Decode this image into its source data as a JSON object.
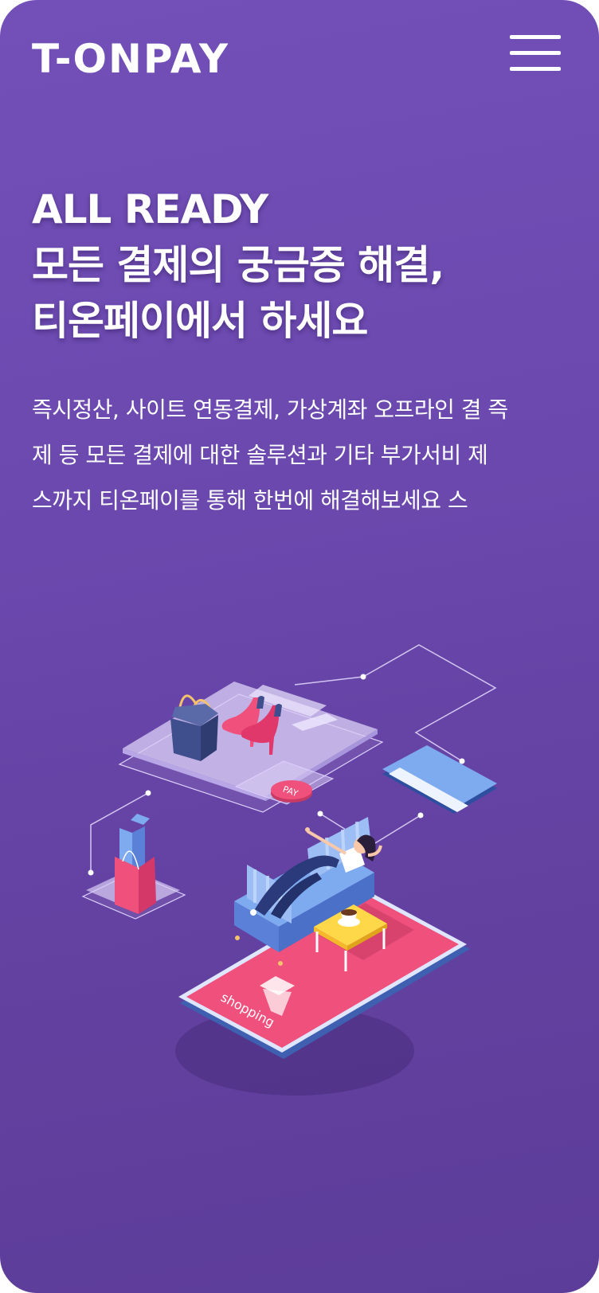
{
  "header": {
    "brand": "T-ONPAY",
    "menu_icon": "hamburger-menu-icon"
  },
  "hero": {
    "title_lines": [
      "ALL READY",
      "모든 결제의 궁금증 해결,",
      "티온페이에서 하세요"
    ],
    "description_lines": [
      "즉시정산, 사이트 연동결제, 가상계좌 오프라인 결 즉",
      "제 등 모든 결제에 대한 솔루션과 기타 부가서비 제",
      "스까지 티온페이를 통해 한번에 해결해보세요 스"
    ]
  },
  "illustration": {
    "pay_badge": "PAY",
    "phone_screen_label": "shopping",
    "icons": [
      "handbag-icon",
      "high-heels-icon",
      "credit-card-icon",
      "shopping-bag-icon",
      "smartphone-icon",
      "shopping-basket-icon",
      "sofa-icon",
      "coffee-cup-icon"
    ]
  },
  "colors": {
    "background_top": "#7250b8",
    "background_bottom": "#5c3d99",
    "accent_pink": "#f0507c",
    "accent_blue": "#7eaaf0",
    "text": "#ffffff"
  }
}
